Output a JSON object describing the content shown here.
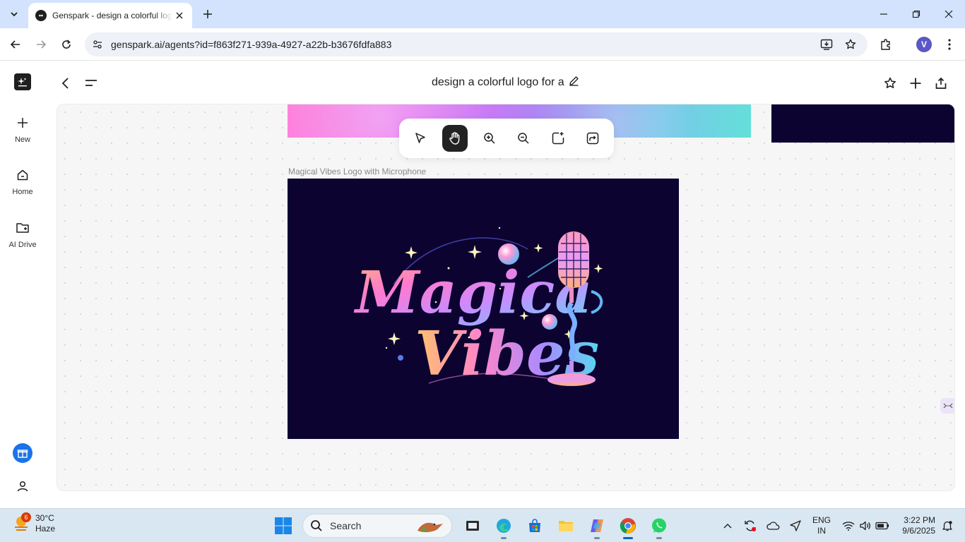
{
  "browser": {
    "tab_title": "Genspark - design a colorful logo",
    "url": "genspark.ai/agents?id=f863f271-939a-4927-a22b-b3676fdfa883",
    "profile_initial": "V"
  },
  "sidebar": {
    "items": [
      {
        "label": "New",
        "icon": "plus-icon"
      },
      {
        "label": "Home",
        "icon": "home-icon"
      },
      {
        "label": "AI Drive",
        "icon": "folder-icon"
      }
    ]
  },
  "header": {
    "title": "design a colorful logo for a"
  },
  "canvas": {
    "image_caption": "Magical Vibes Logo with Microphone",
    "logo_text_line1": "Magica",
    "logo_text_line2": "Vibes"
  },
  "taskbar": {
    "weather_temp": "30°C",
    "weather_desc": "Haze",
    "weather_badge": "6",
    "search_placeholder": "Search",
    "lang_line1": "ENG",
    "lang_line2": "IN",
    "time": "3:22 PM",
    "date": "9/6/2025"
  },
  "colors": {
    "canvas_bg": "#f6f6f6",
    "logo_bg": "#0c0330",
    "accent_blue": "#1a73e8",
    "tab_strip": "#d3e3fd"
  }
}
